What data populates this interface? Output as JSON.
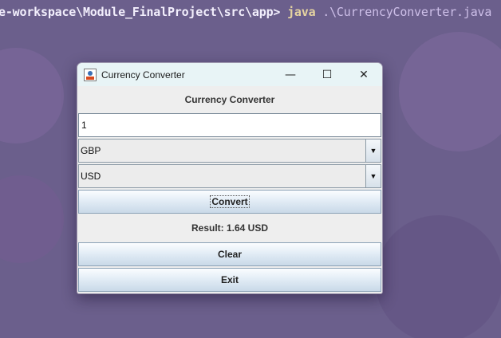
{
  "terminal": {
    "path": "e-workspace\\Module_FinalProject\\src\\app>",
    "command": "java",
    "argument": ".\\CurrencyConverter.java"
  },
  "window": {
    "title": "Currency Converter",
    "minimize_label": "—",
    "maximize_label": "☐",
    "close_label": "✕"
  },
  "form": {
    "heading": "Currency Converter",
    "amount_value": "1",
    "from_currency": "GBP",
    "to_currency": "USD",
    "convert_label": "Convert",
    "result_text": "Result: 1.64 USD",
    "clear_label": "Clear",
    "exit_label": "Exit"
  }
}
